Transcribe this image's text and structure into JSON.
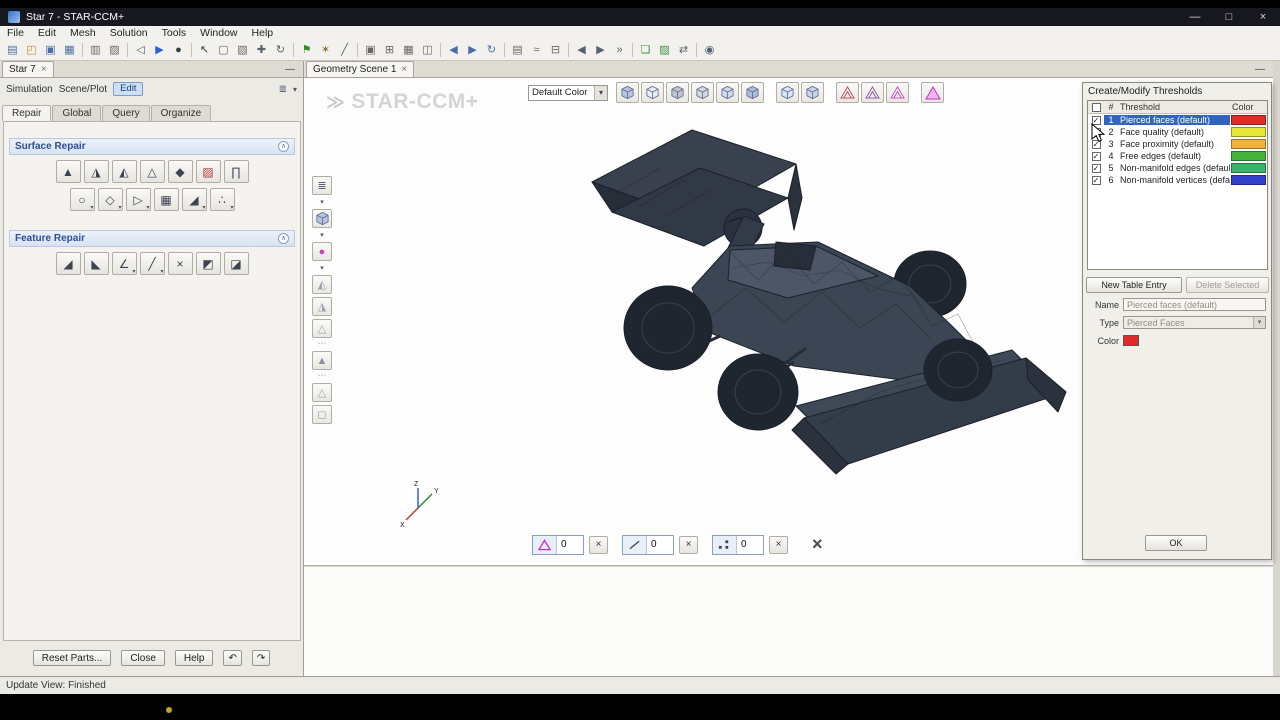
{
  "titlebar": {
    "title": "Star 7 - STAR-CCM+",
    "minimize": "—",
    "maximize": "□",
    "close": "×"
  },
  "menubar": {
    "items": [
      "File",
      "Edit",
      "Mesh",
      "Solution",
      "Tools",
      "Window",
      "Help"
    ]
  },
  "toolbar": {
    "items": [
      {
        "name": "new-file",
        "glyph": "▤",
        "color": "#4a6da8"
      },
      {
        "name": "open-file",
        "glyph": "◰",
        "color": "#b8912f"
      },
      {
        "name": "save",
        "glyph": "▣",
        "color": "#4a6da8"
      },
      {
        "name": "save-all",
        "glyph": "▦",
        "color": "#4a6da8"
      },
      {
        "sep": true
      },
      {
        "name": "copy",
        "glyph": "▥",
        "color": "#6a675f"
      },
      {
        "name": "paste",
        "glyph": "▨",
        "color": "#6a675f"
      },
      {
        "sep": true
      },
      {
        "name": "step-back",
        "glyph": "◁",
        "color": "#55616e"
      },
      {
        "name": "run-simulation",
        "glyph": "▶",
        "color": "#2d5fd0"
      },
      {
        "name": "stop",
        "glyph": "●",
        "color": "#333b44"
      },
      {
        "sep": true
      },
      {
        "name": "select-pointer",
        "glyph": "↖",
        "color": "#333b44"
      },
      {
        "name": "rubberband-select",
        "glyph": "▢",
        "color": "#6a675f"
      },
      {
        "name": "zone-select",
        "glyph": "▧",
        "color": "#6a675f"
      },
      {
        "name": "pan-view",
        "glyph": "✚",
        "color": "#55616e"
      },
      {
        "name": "rotate-view",
        "glyph": "↻",
        "color": "#55616e"
      },
      {
        "sep": true
      },
      {
        "name": "flag-scene",
        "glyph": "⚑",
        "color": "#2f8f2f"
      },
      {
        "name": "probe-point",
        "glyph": "✶",
        "color": "#8a6d2f"
      },
      {
        "name": "measure-distance",
        "glyph": "╱",
        "color": "#55616e"
      },
      {
        "sep": true
      },
      {
        "name": "snapshot",
        "glyph": "▣",
        "color": "#6a675f"
      },
      {
        "name": "show-grid",
        "glyph": "⊞",
        "color": "#6a675f"
      },
      {
        "name": "data-table",
        "glyph": "▦",
        "color": "#6a675f"
      },
      {
        "name": "copy-view",
        "glyph": "◫",
        "color": "#6a675f"
      },
      {
        "sep": true
      },
      {
        "name": "previous-view",
        "glyph": "◀",
        "color": "#4a6da8"
      },
      {
        "name": "next-view",
        "glyph": "▶",
        "color": "#4a6da8"
      },
      {
        "name": "refresh-view",
        "glyph": "↻",
        "color": "#4a6da8"
      },
      {
        "sep": true
      },
      {
        "name": "spreadsheet",
        "glyph": "▤",
        "color": "#6a675f"
      },
      {
        "name": "plot-monitor",
        "glyph": "≈",
        "color": "#6a675f"
      },
      {
        "name": "layout-windows",
        "glyph": "⊟",
        "color": "#6a675f"
      },
      {
        "sep": true
      },
      {
        "name": "step-backward",
        "glyph": "◀",
        "color": "#55616e"
      },
      {
        "name": "play-animation",
        "glyph": "▶",
        "color": "#55616e"
      },
      {
        "name": "jump-to-end",
        "glyph": "»",
        "color": "#55616e"
      },
      {
        "sep": true
      },
      {
        "name": "copy-scene",
        "glyph": "❏",
        "color": "#3f8f3f"
      },
      {
        "name": "paste-scene",
        "glyph": "▨",
        "color": "#3f8f3f"
      },
      {
        "name": "sync-views",
        "glyph": "⇄",
        "color": "#55616e"
      },
      {
        "sep": true
      },
      {
        "name": "settings",
        "glyph": "◉",
        "color": "#55616e"
      }
    ]
  },
  "left": {
    "tab": {
      "label": "Star 7",
      "close": "×",
      "minimize": "—"
    },
    "mode_row": {
      "labels": [
        "Simulation",
        "Scene/Plot"
      ],
      "edit": "Edit",
      "tree_icon": "≣",
      "chevron": "▾"
    },
    "tabs": [
      "Repair",
      "Global",
      "Query",
      "Organize"
    ],
    "surface": {
      "title": "Surface Repair",
      "row1": [
        {
          "name": "zip-edges",
          "glyph": "▲"
        },
        {
          "name": "fill-holes",
          "glyph": "◮"
        },
        {
          "name": "patch-surface",
          "glyph": "◭"
        },
        {
          "name": "smooth-vertices",
          "glyph": "△"
        },
        {
          "name": "collapse-faces",
          "glyph": "◆"
        },
        {
          "name": "find-pierced-faces",
          "glyph": "▨",
          "color": "#b03a3a"
        },
        {
          "name": "repair-tools",
          "glyph": "∏"
        }
      ],
      "row2": [
        {
          "name": "sphere-select",
          "glyph": "○",
          "drop": true
        },
        {
          "name": "expand-selection",
          "glyph": "◇",
          "drop": true
        },
        {
          "name": "selection-filter",
          "glyph": "▷",
          "drop": true
        },
        {
          "name": "fill-region",
          "glyph": "▦"
        },
        {
          "name": "swap-edges",
          "glyph": "◢",
          "drop": true
        },
        {
          "name": "vertex-tools",
          "glyph": "∴",
          "drop": true
        }
      ]
    },
    "feature": {
      "title": "Feature Repair",
      "row": [
        {
          "name": "mark-feature-edges",
          "glyph": "◢"
        },
        {
          "name": "unmark-feature-edges",
          "glyph": "◣"
        },
        {
          "name": "feature-angle",
          "glyph": "∠",
          "drop": true
        },
        {
          "name": "split-edges",
          "glyph": "╱",
          "drop": true
        },
        {
          "name": "merge-edges",
          "glyph": "×"
        },
        {
          "name": "part-rotate-left",
          "glyph": "◩"
        },
        {
          "name": "part-rotate-right",
          "glyph": "◪"
        }
      ]
    },
    "footer_buttons": [
      "Reset Parts...",
      "Close",
      "Help"
    ],
    "footer_icons": [
      {
        "name": "undo",
        "glyph": "↶"
      },
      {
        "name": "redo",
        "glyph": "↷"
      }
    ],
    "status": "Update View: Finished"
  },
  "scene": {
    "tab": {
      "label": "Geometry Scene 1",
      "close": "×",
      "minimize": "—"
    },
    "watermark": "STAR-CCM+",
    "logo": "≫",
    "color_combo": "Default Color",
    "combo_arrow": "▾",
    "view_icons": [
      {
        "name": "render-solid",
        "type": "cube",
        "fill": "#b6c4de"
      },
      {
        "name": "render-wireframe",
        "type": "cube",
        "fill": "#e9eef7"
      },
      {
        "name": "render-hidden",
        "type": "cube",
        "fill": "#c2c6cc"
      },
      {
        "name": "render-flat",
        "type": "cube",
        "fill": "#d4d7db"
      },
      {
        "name": "render-outline",
        "type": "cube",
        "fill": "#cfd9ea"
      },
      {
        "name": "render-surface-mesh",
        "type": "cube",
        "fill": "#aebddb"
      },
      {
        "type": "gap"
      },
      {
        "name": "render-edges",
        "type": "cube",
        "fill": "#dce6f4"
      },
      {
        "name": "render-points",
        "type": "cube",
        "fill": "#c8d4e8"
      },
      {
        "type": "gap"
      },
      {
        "name": "mesh-quality-red",
        "type": "mesh",
        "color": "#c2425f"
      },
      {
        "name": "mesh-quality-violet",
        "type": "mesh",
        "color": "#8a4fb0"
      },
      {
        "name": "mesh-quality-pink",
        "type": "mesh",
        "color": "#cc44cc"
      },
      {
        "type": "gap"
      },
      {
        "name": "threshold-display",
        "type": "tri"
      }
    ],
    "side_icons": [
      {
        "name": "display-mode",
        "glyph": "≣",
        "color": "#44506b"
      },
      {
        "name": "chevron-down",
        "glyph": "▾",
        "flat": true
      },
      {
        "name": "parts-cube",
        "type": "cube"
      },
      {
        "name": "chevron-down",
        "glyph": "▾",
        "flat": true
      },
      {
        "name": "probe-sphere",
        "glyph": "●",
        "color": "#cc44cc"
      },
      {
        "name": "chevron-down",
        "glyph": "▾",
        "flat": true
      },
      {
        "name": "select-faces",
        "glyph": "◭",
        "color": "#9aa2ae"
      },
      {
        "name": "select-edges",
        "glyph": "◮",
        "color": "#9aa2ae"
      },
      {
        "name": "select-vertices",
        "glyph": "△",
        "color": "#9aa2ae"
      },
      {
        "type": "dots"
      },
      {
        "name": "grow-selection",
        "glyph": "▲",
        "color": "#8a93a0"
      },
      {
        "type": "dots"
      },
      {
        "name": "shrink-selection",
        "glyph": "△",
        "color": "#9aa2ae"
      },
      {
        "name": "selection-box",
        "glyph": "◻",
        "color": "#9aa2ae"
      }
    ],
    "counters": [
      {
        "name": "face-threshold-counter",
        "icon": "triangle",
        "value": "0"
      },
      {
        "name": "edge-threshold-counter",
        "icon": "line",
        "value": "0"
      },
      {
        "name": "vertex-threshold-counter",
        "icon": "vertex",
        "value": "0"
      }
    ],
    "counter_close": "×",
    "clear_all": "×",
    "axes": {
      "x": "X",
      "y": "Y",
      "z": "Z"
    },
    "expander": "›"
  },
  "right": {
    "title": "Create/Modify Thresholds",
    "table": {
      "headers": [
        "#",
        "Threshold",
        "Color"
      ],
      "rows": [
        {
          "num": "1",
          "label": "Pierced faces (default)",
          "color": "#e02b2b",
          "checked": true,
          "selected": true
        },
        {
          "num": "2",
          "label": "Face quality (default)",
          "color": "#e6e636",
          "checked": true
        },
        {
          "num": "3",
          "label": "Face proximity (default)",
          "color": "#efb33a",
          "checked": true
        },
        {
          "num": "4",
          "label": "Free edges (default)",
          "color": "#43b33c",
          "checked": true
        },
        {
          "num": "5",
          "label": "Non-manifold edges (default)",
          "color": "#39b36b",
          "checked": true
        },
        {
          "num": "6",
          "label": "Non-manifold vertices (default)",
          "color": "#3340cc",
          "checked": true
        }
      ]
    },
    "buttons": {
      "new_entry": "New Table Entry",
      "delete_selected": "Delete Selected",
      "ok": "OK"
    },
    "fields": {
      "name_label": "Name",
      "name_value": "Pierced faces (default)",
      "type_label": "Type",
      "type_value": "Pierced Faces",
      "color_label": "Color",
      "color_value": "#e02b2b"
    }
  }
}
